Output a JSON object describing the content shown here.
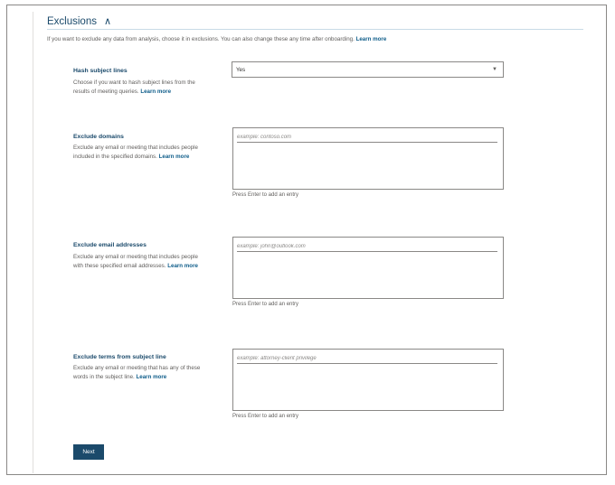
{
  "header": {
    "title": "Exclusions",
    "collapse_icon": "chevron-up-icon"
  },
  "intro": {
    "text": "If you want to exclude any data from analysis, choose it in exclusions. You can also change these any time after onboarding.",
    "link": "Learn more"
  },
  "hash": {
    "title": "Hash subject lines",
    "desc": "Choose if you want to hash subject lines from the results of meeting queries.",
    "link": "Learn more",
    "value": "Yes"
  },
  "domains": {
    "title": "Exclude domains",
    "desc": "Exclude any email or meeting that includes people included in the specified domains.",
    "link": "Learn more",
    "placeholder": "example: contoso.com",
    "hint": "Press Enter to add an entry"
  },
  "emails": {
    "title": "Exclude email addresses",
    "desc": "Exclude any email or meeting that includes people with these specified email addresses.",
    "link": "Learn more",
    "placeholder": "example: john@outlook.com",
    "hint": "Press Enter to add an entry"
  },
  "terms": {
    "title": "Exclude terms from subject line",
    "desc": "Exclude any email or meeting that has any of these words in the subject line.",
    "link": "Learn more",
    "placeholder": "example: attorney-client privilege",
    "hint": "Press Enter to add an entry"
  },
  "next_label": "Next"
}
